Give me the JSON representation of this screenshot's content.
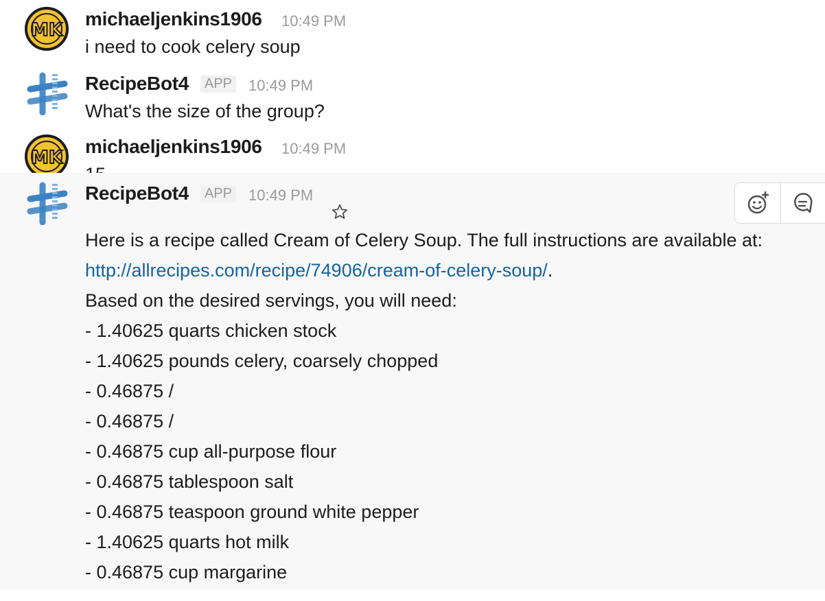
{
  "messages": [
    {
      "author": "michaeljenkins1906",
      "time": "10:49 PM",
      "text": "i need to cook celery soup"
    },
    {
      "author": "RecipeBot4",
      "badge": "APP",
      "time": "10:49 PM",
      "text": "What's the size of the group?"
    },
    {
      "author": "michaeljenkins1906",
      "time": "10:49 PM",
      "text": "15"
    },
    {
      "author": "RecipeBot4",
      "badge": "APP",
      "time": "10:49 PM",
      "intro": "Here is a recipe called Cream of Celery Soup. The full instructions are available at:",
      "link": "http://allrecipes.com/recipe/74906/cream-of-celery-soup/",
      "link_suffix": ".",
      "needs": "Based on the desired servings, you will need:",
      "ingredients": [
        "- 1.40625 quarts chicken stock",
        "- 1.40625 pounds celery, coarsely chopped",
        "- 0.46875 /",
        "- 0.46875 /",
        "- 0.46875 cup all-purpose flour",
        "- 0.46875 tablespoon salt",
        "- 0.46875 teaspoon ground white pepper",
        "- 1.40625 quarts hot milk",
        "- 0.46875 cup margarine"
      ]
    }
  ],
  "icons": {
    "user_avatar": "mk-avatar-icon",
    "bot_avatar": "recipebot-avatar-icon",
    "star": "star-icon",
    "add_reaction": "add-reaction-icon",
    "thread": "thread-icon"
  },
  "colors": {
    "link": "#1264a3",
    "avatar_yellow": "#f2c230",
    "bot_blue": "#3b82c4",
    "highlight": "#f8f8f8"
  }
}
